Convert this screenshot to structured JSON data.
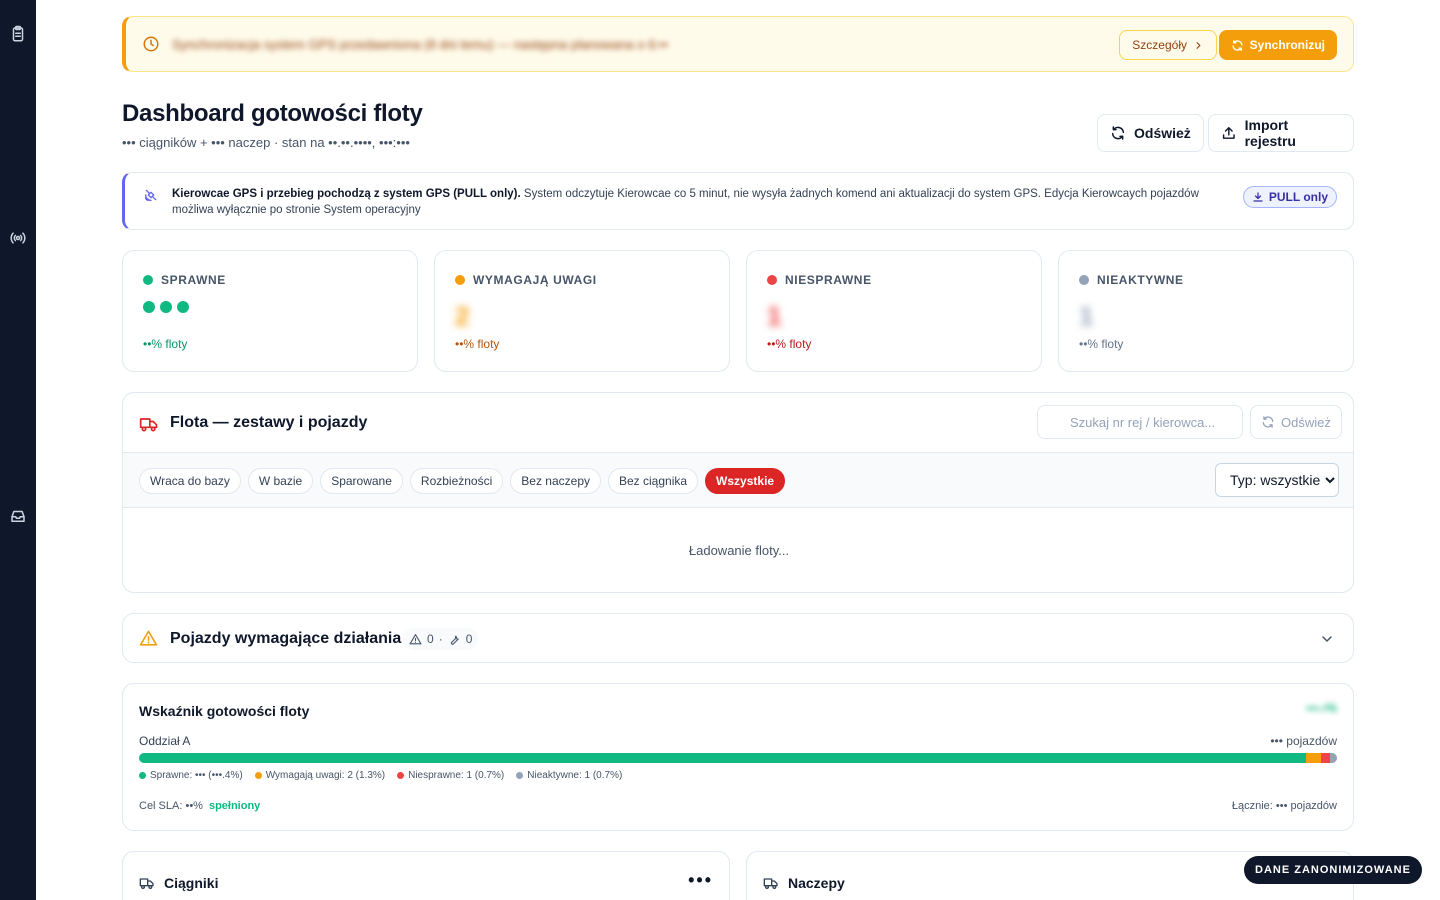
{
  "colors": {
    "sidebar": "#0f172a",
    "ok": "#10b981",
    "warning": "#f59e0b",
    "error": "#ef4444",
    "inactive": "#94a3b8",
    "accent_red": "#dc2626",
    "indigo": "#6366f1"
  },
  "sidebar": {
    "items": [
      {
        "icon": "clipboard-icon"
      },
      {
        "icon": "broadcast-icon"
      },
      {
        "icon": "inbox-icon"
      }
    ]
  },
  "banner": {
    "text": "Synchronizacja system GPS przedawniona (8 dni temu) — następna planowana o 6:••",
    "details_label": "Szczegóły",
    "sync_label": "Synchronizuj"
  },
  "header": {
    "title": "Dashboard gotowości floty",
    "subtitle": "••• ciągników + ••• naczep · stan na ••.••.••••, •••:•••",
    "refresh_label": "Odśwież",
    "import_label": "Import rejestru"
  },
  "info": {
    "bold": "Kierowcae GPS i przebieg pochodzą z system GPS (PULL only).",
    "text": " System odczytuje Kierowcae co 5 minut, nie wysyła żadnych komend ani aktualizacji do system GPS. Edycja Kierowcaych pojazdów możliwa wyłącznie po stronie System operacyjny",
    "badge": "PULL only"
  },
  "stats": [
    {
      "label": "SPRAWNE",
      "value": "•••",
      "pct": "••% floty",
      "color": "#10b981"
    },
    {
      "label": "WYMAGAJĄ UWAGI",
      "value": "2",
      "pct": "••% floty",
      "color": "#f59e0b"
    },
    {
      "label": "NIESPRAWNE",
      "value": "1",
      "pct": "••% floty",
      "color": "#ef4444"
    },
    {
      "label": "NIEAKTYWNE",
      "value": "1",
      "pct": "••% floty",
      "color": "#94a3b8"
    }
  ],
  "fleet": {
    "title": "Flota — zestawy i pojazdy",
    "search_placeholder": "Szukaj nr rej / kierowca...",
    "refresh_label": "Odśwież",
    "filters": [
      "Wraca do bazy",
      "W bazie",
      "Sparowane",
      "Rozbieżności",
      "Bez naczepy",
      "Bez ciągnika",
      "Wszystkie"
    ],
    "active_filter": "Wszystkie",
    "type_select": "Typ: wszystkie",
    "loading": "Ładowanie floty..."
  },
  "actions": {
    "title": "Pojazdy wymagające działania",
    "warnings": "0",
    "repairs": "0"
  },
  "readiness": {
    "title": "Wskaźnik gotowości floty",
    "badge": "•••.•%",
    "branch": "Oddział A",
    "branch_count": "••• pojazdów",
    "segments": [
      {
        "name": "Sprawne",
        "percent": 97.4,
        "color": "#10b981"
      },
      {
        "name": "Wymagają uwagi",
        "percent": 1.3,
        "color": "#f59e0b"
      },
      {
        "name": "Niesprawne",
        "percent": 0.7,
        "color": "#ef4444"
      },
      {
        "name": "Nieaktywne",
        "percent": 0.6,
        "color": "#94a3b8"
      }
    ],
    "legend": [
      "Sprawne: ••• (•••.4%)",
      "Wymagają uwagi: 2 (1.3%)",
      "Niesprawne: 1 (0.7%)",
      "Nieaktywne: 1 (0.7%)"
    ],
    "sla_label": "Cel SLA: ••%",
    "sla_status": "spełniony",
    "total": "Łącznie: ••• pojazdów"
  },
  "cards": {
    "tractors": {
      "title": "Ciągniki",
      "value": "•••"
    },
    "trailers": {
      "title": "Naczepy",
      "value": "•••"
    }
  },
  "anon_badge": "DANE ZANONIMIZOWANE"
}
